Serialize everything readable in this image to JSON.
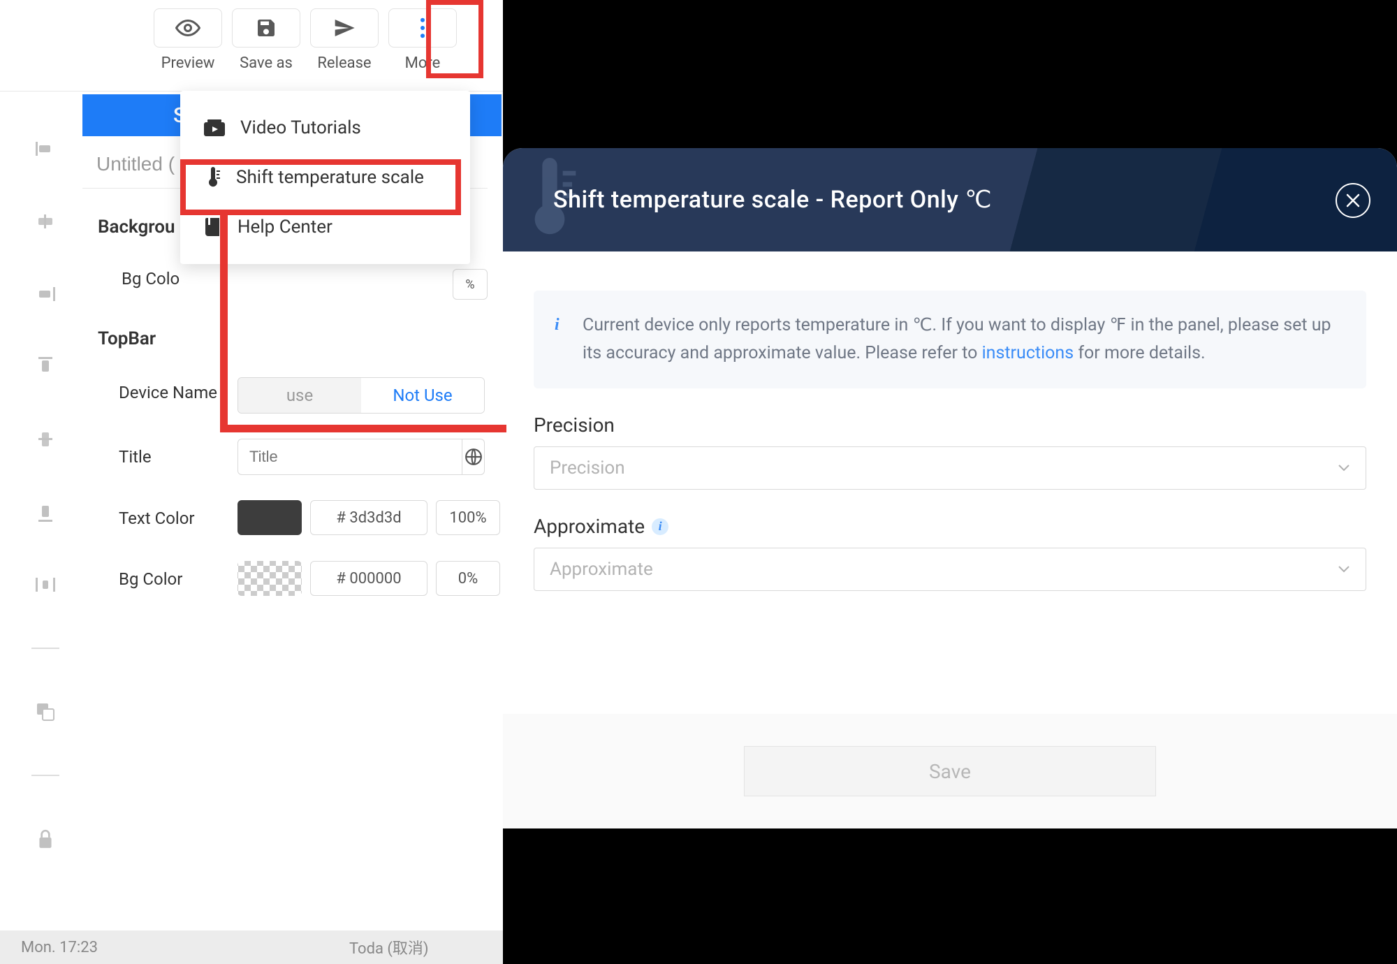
{
  "toolbar": {
    "preview_label": "Preview",
    "saveas_label": "Save as",
    "release_label": "Release",
    "more_label": "More"
  },
  "blue_bar_letter": "S",
  "untitled_value": "Untitled (",
  "section_background_label": "Backgrou",
  "row_bgcolor1_label": "Bg Colo",
  "small_pill_value": "%",
  "section_topbar_label": "TopBar",
  "device_name_label": "Device Name",
  "device_toggle": {
    "opt_use": "use",
    "opt_not_use": "Not Use"
  },
  "title_row_label": "Title",
  "title_placeholder": "Title",
  "text_color_label": "Text Color",
  "text_color_hex": "# 3d3d3d",
  "text_color_pct": "100%",
  "bg_color2_label": "Bg Color",
  "bg_color2_hex": "# 000000",
  "bg_color2_pct": "0%",
  "status": {
    "left": "Mon. 17:23",
    "right": "Toda (取消)"
  },
  "more_menu": {
    "video_tutorials": "Video Tutorials",
    "shift_temp": "Shift temperature scale",
    "help_center": "Help Center"
  },
  "dialog": {
    "title": "Shift temperature scale - Report Only ℃",
    "info_prefix": "Current device only reports temperature in ℃. If you want to display ℉ in the panel, please set up its accuracy and approximate value. Please refer to ",
    "info_link": "instructions",
    "info_suffix": " for more details.",
    "precision_label": "Precision",
    "precision_placeholder": "Precision",
    "approximate_label": "Approximate",
    "approximate_placeholder": "Approximate",
    "save_label": "Save"
  }
}
